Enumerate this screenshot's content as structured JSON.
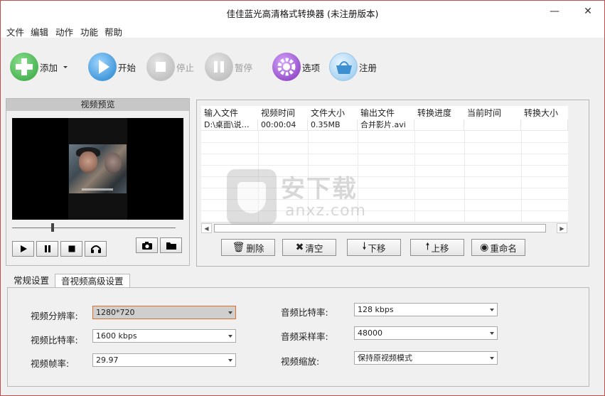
{
  "window": {
    "title": "佳佳蓝光高清格式转换器 (未注册版本)",
    "minimize_glyph": "—",
    "close_glyph": "✕"
  },
  "menu": [
    "文件",
    "编辑",
    "动作",
    "功能",
    "帮助"
  ],
  "toolbar": {
    "add": "添加",
    "start": "开始",
    "stop": "停止",
    "pause": "暂停",
    "options": "选项",
    "register": "注册"
  },
  "preview": {
    "title": "视频预览"
  },
  "filelist": {
    "columns": [
      "输入文件",
      "视频时间",
      "文件大小",
      "输出文件",
      "转换进度",
      "当前时间",
      "转换大小"
    ],
    "rows": [
      [
        "D:\\桌面\\说…",
        "00:00:04",
        "0.35MB",
        "合并影片.avi",
        "",
        "",
        ""
      ]
    ]
  },
  "actions": {
    "delete": "删除",
    "clear": "清空",
    "down": "下移",
    "up": "上移",
    "rename": "重命名"
  },
  "watermark": {
    "text": "安下载",
    "sub": "anxz.com"
  },
  "tabs": {
    "general": "常规设置",
    "advanced": "音视频高级设置"
  },
  "settings": {
    "resolution_label": "视频分辨率:",
    "resolution": "1280*720",
    "vbitrate_label": "视频比特率:",
    "vbitrate": "1600 kbps",
    "fps_label": "视频帧率:",
    "fps": "29.97",
    "abitrate_label": "音频比特率:",
    "abitrate": "128 kbps",
    "samplerate_label": "音频采样率:",
    "samplerate": "48000",
    "scale_label": "视频缩放:",
    "scale": "保持原视频模式"
  },
  "colors": {
    "add": "#3bb34a",
    "start": "#2e8fd6",
    "disabled": "#bdbdbd",
    "options": "#8f3fc4",
    "register": "#5aa6dc",
    "window_border": "#c24d4d"
  }
}
